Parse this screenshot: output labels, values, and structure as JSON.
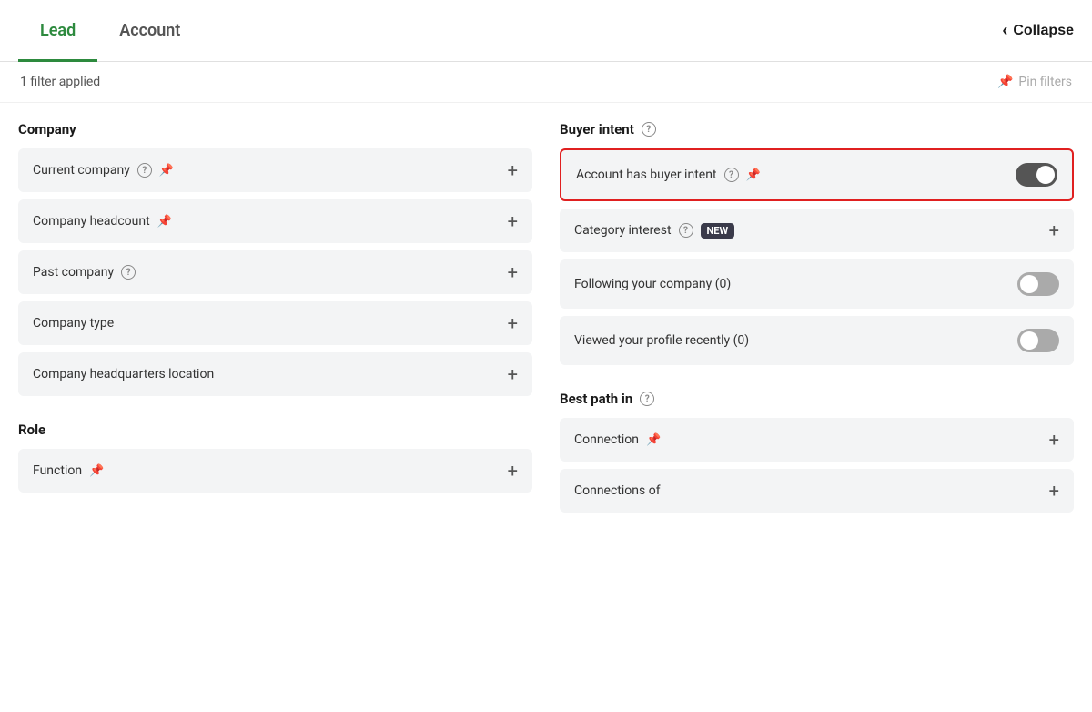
{
  "tabs": [
    {
      "id": "lead",
      "label": "Lead",
      "active": true
    },
    {
      "id": "account",
      "label": "Account",
      "active": false
    }
  ],
  "collapse_label": "Collapse",
  "filter_count": "1 filter applied",
  "pin_filters_label": "Pin filters",
  "left_column": {
    "company_section": {
      "title": "Company",
      "items": [
        {
          "label": "Current company",
          "has_question": true,
          "has_pin": true,
          "has_plus": true
        },
        {
          "label": "Company headcount",
          "has_question": false,
          "has_pin": true,
          "has_plus": true
        },
        {
          "label": "Past company",
          "has_question": true,
          "has_pin": false,
          "has_plus": true
        },
        {
          "label": "Company type",
          "has_question": false,
          "has_pin": false,
          "has_plus": true
        },
        {
          "label": "Company headquarters location",
          "has_question": false,
          "has_pin": false,
          "has_plus": true
        }
      ]
    },
    "role_section": {
      "title": "Role",
      "items": [
        {
          "label": "Function",
          "has_question": false,
          "has_pin": true,
          "has_plus": true
        }
      ]
    }
  },
  "right_column": {
    "buyer_intent_section": {
      "title": "Buyer intent",
      "has_question": true,
      "items": [
        {
          "label": "Account has buyer intent",
          "has_question": true,
          "has_pin": true,
          "is_toggle": true,
          "toggle_on": true,
          "highlighted": true
        },
        {
          "label": "Category interest",
          "has_question": true,
          "has_pin": false,
          "is_new": true,
          "is_toggle": false,
          "has_plus": true
        },
        {
          "label": "Following your company (0)",
          "has_question": false,
          "has_pin": false,
          "is_toggle": true,
          "toggle_on": false
        },
        {
          "label": "Viewed your profile recently (0)",
          "has_question": false,
          "has_pin": false,
          "is_toggle": true,
          "toggle_on": false
        }
      ]
    },
    "best_path_section": {
      "title": "Best path in",
      "has_question": true,
      "items": [
        {
          "label": "Connection",
          "has_pin": true,
          "has_plus": true
        },
        {
          "label": "Connections of",
          "has_pin": false,
          "has_plus": true
        }
      ]
    }
  }
}
